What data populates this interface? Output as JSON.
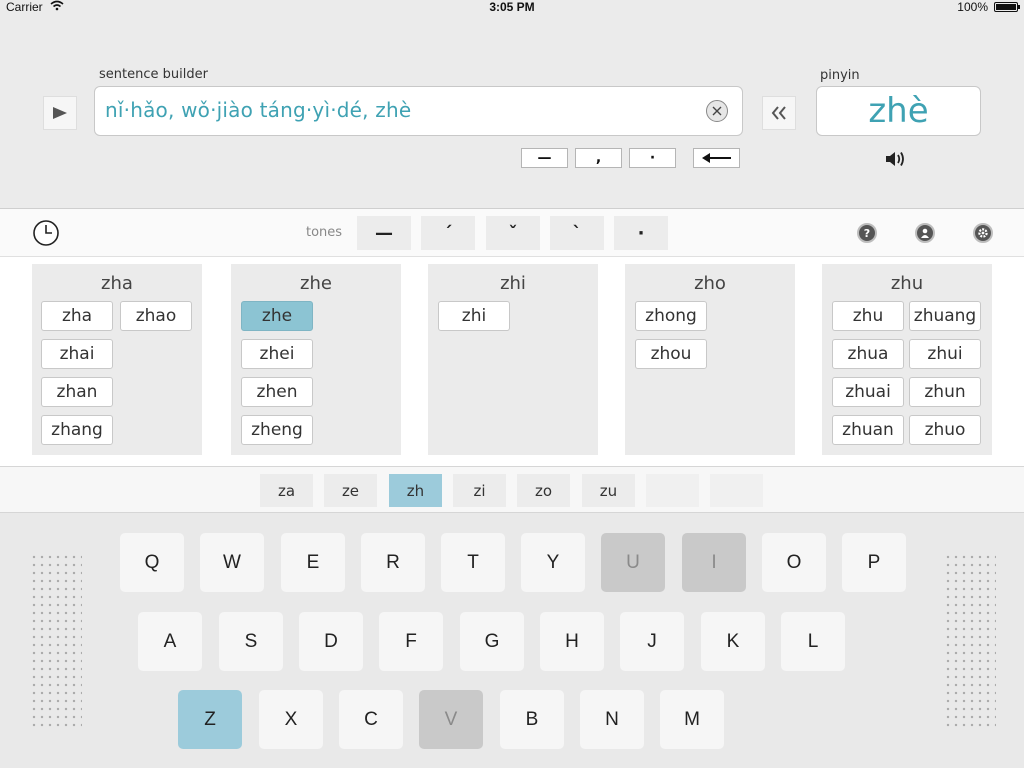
{
  "status_bar": {
    "carrier": "Carrier",
    "time": "3:05 PM",
    "battery": "100%"
  },
  "sentence_builder": {
    "label": "sentence builder",
    "text": "nǐ·hǎo, wǒ·jiào táng·yì·dé, zhè"
  },
  "punctuation": [
    "—",
    ",",
    "·"
  ],
  "pinyin": {
    "label": "pinyin",
    "value": "zhè"
  },
  "tones": {
    "label": "tones",
    "marks": [
      "—",
      "ˊ",
      "ˇ",
      "ˋ",
      "·"
    ]
  },
  "groups": [
    {
      "title": "zha",
      "items": [
        "zha",
        "zhao",
        "zhai",
        "zhan",
        "zhang"
      ]
    },
    {
      "title": "zhe",
      "items": [
        "zhe",
        "zhei",
        "zhen",
        "zheng"
      ]
    },
    {
      "title": "zhi",
      "items": [
        "zhi"
      ]
    },
    {
      "title": "zho",
      "items": [
        "zhong",
        "zhou"
      ]
    },
    {
      "title": "zhu",
      "items": [
        "zhu",
        "zhuang",
        "zhua",
        "zhui",
        "zhuai",
        "zhun",
        "zhuan",
        "zhuo"
      ]
    }
  ],
  "selected_syllable": "zhe",
  "initials": [
    "za",
    "ze",
    "zh",
    "zi",
    "zo",
    "zu"
  ],
  "selected_initial": "zh",
  "keyboard": {
    "row1": [
      "Q",
      "W",
      "E",
      "R",
      "T",
      "Y",
      "U",
      "I",
      "O",
      "P"
    ],
    "row2": [
      "A",
      "S",
      "D",
      "F",
      "G",
      "H",
      "J",
      "K",
      "L"
    ],
    "row3": [
      "Z",
      "X",
      "C",
      "V",
      "B",
      "N",
      "M"
    ],
    "disabled": [
      "U",
      "I",
      "V"
    ],
    "active": [
      "Z"
    ]
  },
  "colors": {
    "accent": "#3fa2b3",
    "selected": "#8cc4d3",
    "key_active": "#9ccbdb",
    "key_disabled": "#c9c9c9"
  },
  "icons": {
    "play": "play-icon",
    "clear": "clear-icon",
    "backspace": "backspace-arrow-icon",
    "back": "double-chevron-left-icon",
    "speaker": "speaker-icon",
    "history": "clock-icon",
    "help": "question-icon",
    "profile": "person-icon",
    "settings": "gear-icon"
  }
}
